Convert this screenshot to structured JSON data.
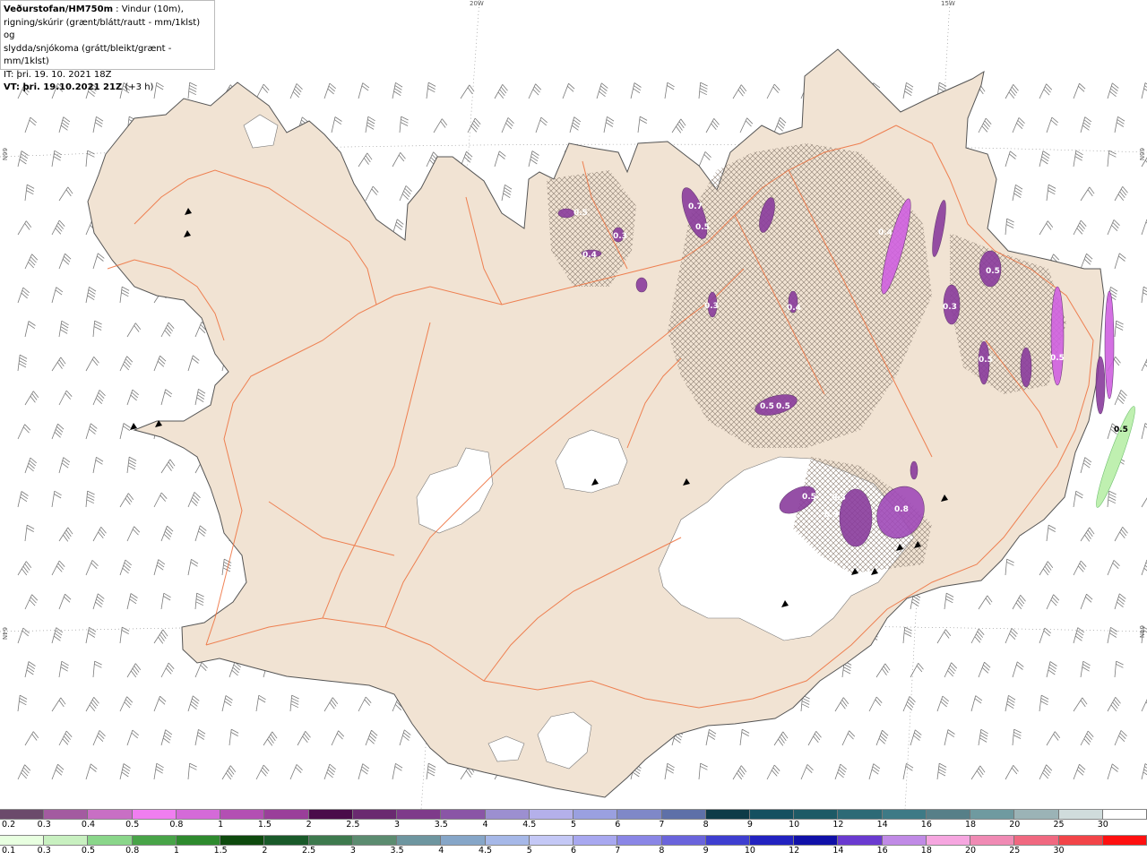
{
  "header": {
    "source": "Veðurstofan/HM750m",
    "description_line1": " : Vindur (10m),",
    "description_line2": "rigning/skúrir (grænt/blátt/rautt - mm/1klst) og",
    "description_line3": "slydda/snjókoma (grátt/bleikt/grænt - mm/1klst)",
    "init_time": "IT: þri. 19. 10. 2021 18Z",
    "valid_prefix": "VT: þri. 19.10.2021 21Z",
    "valid_suffix": " (+3 h)"
  },
  "coordinates": {
    "top_left_lon": "20W",
    "top_right_lon": "15W",
    "left_top_lat": "66N",
    "left_bottom_lat": "64N",
    "right_top_lat": "66N",
    "right_bottom_lat": "64N"
  },
  "map": {
    "land_color": "#f1e3d3",
    "road_color": "#ee6e3a",
    "glacier_color": "#ffffff",
    "precip_labels": [
      "0.7",
      "0.5",
      "0.3",
      "0.4",
      "0.5",
      "0.3",
      "0.4",
      "0.5",
      "0.5",
      "0.4",
      "0.3",
      "0.8",
      "0.3",
      "0.5",
      "0.3",
      "0.5",
      "0.5",
      "0.5"
    ],
    "east_value": "0.5"
  },
  "legend_snow": {
    "labels": [
      "0.2",
      "0.3",
      "0.4",
      "0.5",
      "0.8",
      "1",
      "1.5",
      "2",
      "2.5",
      "3",
      "3.5",
      "4",
      "4.5",
      "5",
      "6",
      "7",
      "8",
      "9",
      "10",
      "12",
      "14",
      "16",
      "18",
      "20",
      "25",
      "30"
    ],
    "colors": [
      "#6b4a6b",
      "#a35ba0",
      "#c86fc4",
      "#f07ef0",
      "#d46ad8",
      "#b34fb3",
      "#9a3f9a",
      "#4a0c4a",
      "#6a2a70",
      "#7e3a8a",
      "#8a55a6",
      "#9c8fd0",
      "#b4b0ea",
      "#9aa0e0",
      "#7f88c8",
      "#5e70a8",
      "#0e3b48",
      "#155060",
      "#1d5a66",
      "#2d6a76",
      "#3e7a86",
      "#577f88",
      "#6f9aa0",
      "#9bb3b6",
      "#d0dcdc",
      "#ffffff"
    ]
  },
  "legend_rain": {
    "labels": [
      "0.1",
      "0.3",
      "0.5",
      "0.8",
      "1",
      "1.5",
      "2",
      "2.5",
      "3",
      "3.5",
      "4",
      "4.5",
      "5",
      "6",
      "7",
      "8",
      "9",
      "10",
      "12",
      "14",
      "16",
      "18",
      "20",
      "25",
      "30"
    ],
    "colors": [
      "#e8ffe0",
      "#c8f0c0",
      "#8ad68a",
      "#48a448",
      "#2e8a2e",
      "#0e4a0e",
      "#1a5a2a",
      "#3e7a4e",
      "#5c8c70",
      "#6e96a0",
      "#86a6c8",
      "#a6b8e8",
      "#c4c8f6",
      "#a8a8f0",
      "#8a86e6",
      "#6a64dc",
      "#3e3ed0",
      "#2222c0",
      "#1010a8",
      "#6a3ad0",
      "#c08ae6",
      "#f6a6e0",
      "#f08ab4",
      "#f06880",
      "#f24448",
      "#ff1010"
    ]
  }
}
